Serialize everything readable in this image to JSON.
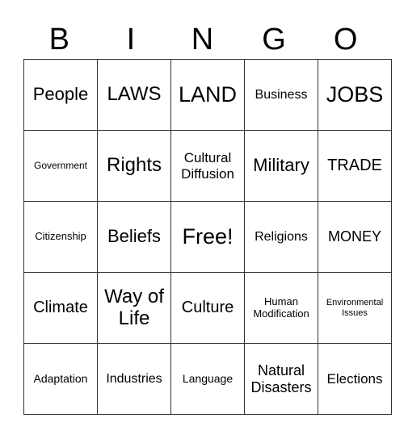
{
  "header": [
    "B",
    "I",
    "N",
    "G",
    "O"
  ],
  "rows": [
    [
      "People",
      "LAWS",
      "LAND",
      "Business",
      "JOBS"
    ],
    [
      "Government",
      "Rights",
      "Cultural Diffusion",
      "Military",
      "TRADE"
    ],
    [
      "Citizenship",
      "Beliefs",
      "Free!",
      "Religions",
      "MONEY"
    ],
    [
      "Climate",
      "Way of Life",
      "Culture",
      "Human Modification",
      "Environmental Issues"
    ],
    [
      "Adaptation",
      "Industries",
      "Language",
      "Natural Disasters",
      "Elections"
    ]
  ]
}
